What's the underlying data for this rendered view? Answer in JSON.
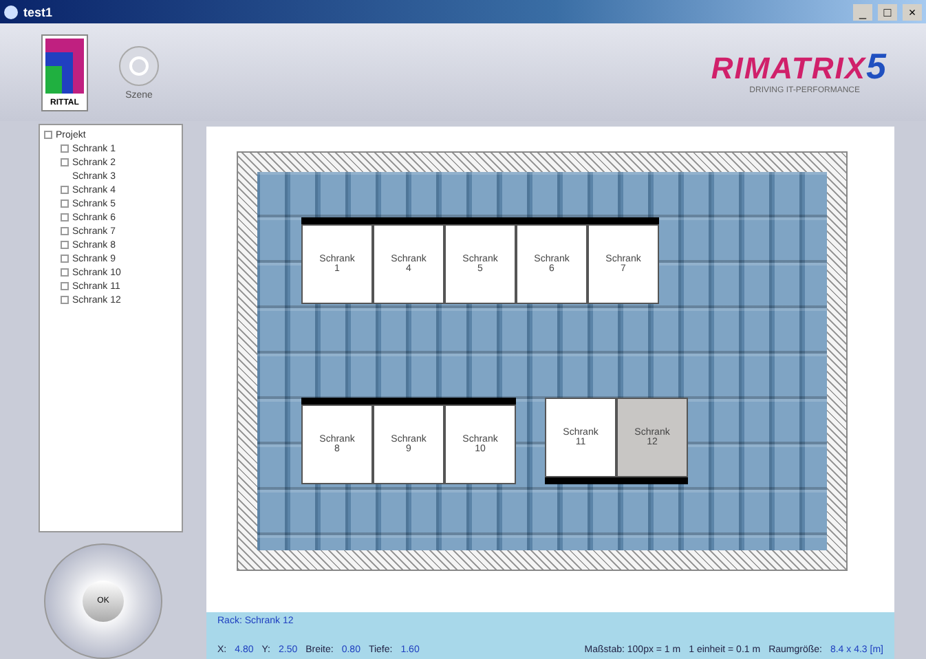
{
  "window": {
    "title": "test1",
    "controls": [
      "_",
      "□",
      "×"
    ]
  },
  "header": {
    "logo_text": "RITTAL",
    "scene_button": "Szene",
    "brand_name": "RIMATRIX",
    "brand_mark": "5",
    "brand_tagline": "DRIVING IT-PERFORMANCE"
  },
  "tree": {
    "label": "Projekt",
    "expanded": true,
    "children": [
      {
        "label": "Schrank 1",
        "expandable": true
      },
      {
        "label": "Schrank 2",
        "expandable": true
      },
      {
        "label": "Schrank 3",
        "expandable": false
      },
      {
        "label": "Schrank 4",
        "expandable": true
      },
      {
        "label": "Schrank 5",
        "expandable": true
      },
      {
        "label": "Schrank 6",
        "expandable": true
      },
      {
        "label": "Schrank 7",
        "expandable": true
      },
      {
        "label": "Schrank 8",
        "expandable": true
      },
      {
        "label": "Schrank 9",
        "expandable": true
      },
      {
        "label": "Schrank 10",
        "expandable": true
      },
      {
        "label": "Schrank 11",
        "expandable": true
      },
      {
        "label": "Schrank 12",
        "expandable": true
      }
    ]
  },
  "navigator": {
    "center_label": "OK"
  },
  "rack_groups": [
    {
      "door_top": true,
      "racks": [
        {
          "name": "Schrank",
          "number": "1",
          "selected": false
        },
        {
          "name": "Schrank",
          "number": "4",
          "selected": false
        },
        {
          "name": "Schrank",
          "number": "5",
          "selected": false
        },
        {
          "name": "Schrank",
          "number": "6",
          "selected": false
        },
        {
          "name": "Schrank",
          "number": "7",
          "selected": false
        }
      ]
    },
    {
      "door_top": true,
      "racks": [
        {
          "name": "Schrank",
          "number": "8",
          "selected": false
        },
        {
          "name": "Schrank",
          "number": "9",
          "selected": false
        },
        {
          "name": "Schrank",
          "number": "10",
          "selected": false
        }
      ]
    },
    {
      "door_top": false,
      "racks": [
        {
          "name": "Schrank",
          "number": "11",
          "selected": false
        },
        {
          "name": "Schrank",
          "number": "12",
          "selected": true
        }
      ]
    }
  ],
  "status_bar": {
    "rack": "Rack: Schrank 12",
    "fields": [
      {
        "label": "X:",
        "value": "4.80"
      },
      {
        "label": "Y:",
        "value": "2.50"
      },
      {
        "label": "Breite:",
        "value": "0.80"
      },
      {
        "label": "Tiefe:",
        "value": "1.60"
      }
    ],
    "scale": "Maßstab: 100px = 1 m",
    "unit": "1 einheit = 0.1 m",
    "room_label": "Raumgröße:",
    "room_value": "8.4 x 4.3 [m]"
  }
}
